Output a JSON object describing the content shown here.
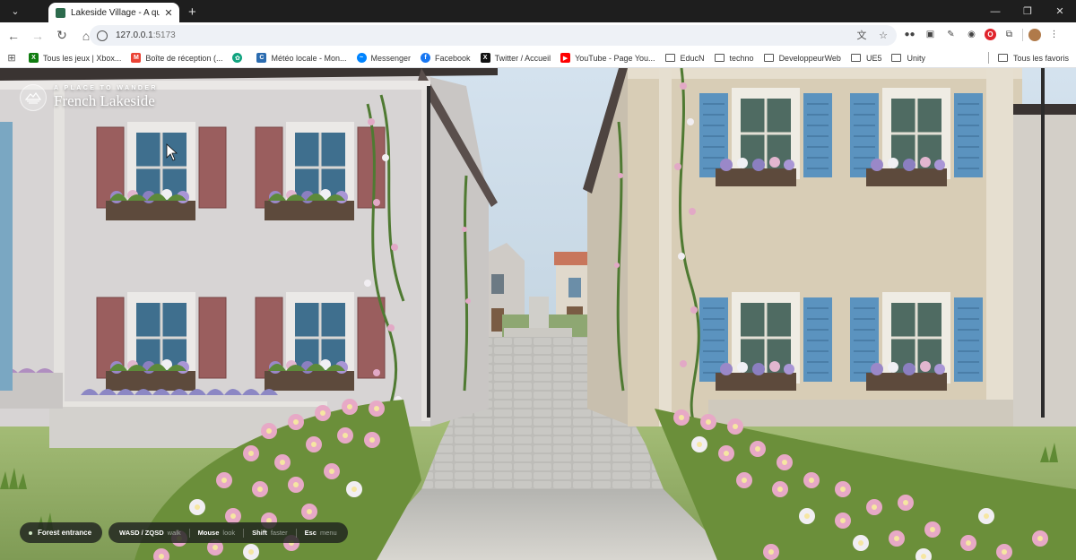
{
  "browser": {
    "tab": {
      "title": "Lakeside Village - A quiet place"
    },
    "address": {
      "host": "127.0.0.1",
      "port": ":5173"
    },
    "bookmarks": [
      {
        "label": "Tous les jeux | Xbox...",
        "icon": "xbox-icon",
        "color": "#107c10"
      },
      {
        "label": "Boîte de réception (...",
        "icon": "gmail-icon",
        "color": "#ea4335"
      },
      {
        "label": "",
        "icon": "chatgpt-icon",
        "color": "#10a37f"
      },
      {
        "label": "Météo locale - Mon...",
        "icon": "weather-icon",
        "color": "#2b6cb0"
      },
      {
        "label": "Messenger",
        "icon": "messenger-icon",
        "color": "#0084ff"
      },
      {
        "label": "Facebook",
        "icon": "facebook-icon",
        "color": "#1877f2"
      },
      {
        "label": "Twitter / Accueil",
        "icon": "x-icon",
        "color": "#111111"
      },
      {
        "label": "YouTube - Page You...",
        "icon": "youtube-icon",
        "color": "#ff0000"
      }
    ],
    "folders": [
      "EducN",
      "techno",
      "DeveloppeurWeb",
      "UE5",
      "Unity"
    ],
    "all_bookmarks": "Tous les favoris"
  },
  "app": {
    "kicker": "A PLACE TO WANDER",
    "title": "French Lakeside",
    "location": "Forest entrance",
    "controls": [
      {
        "key": "WASD / ZQSD",
        "action": "walk"
      },
      {
        "key": "Mouse",
        "action": "look"
      },
      {
        "key": "Shift",
        "action": "faster"
      },
      {
        "key": "Esc",
        "action": "menu"
      }
    ]
  },
  "colors": {
    "shutter_left": "#9a5e5e",
    "shutter_right": "#5b93bf",
    "wall_left": "#d7d4d4",
    "wall_right": "#d8cdb6",
    "sky": "#c9d8e6"
  }
}
